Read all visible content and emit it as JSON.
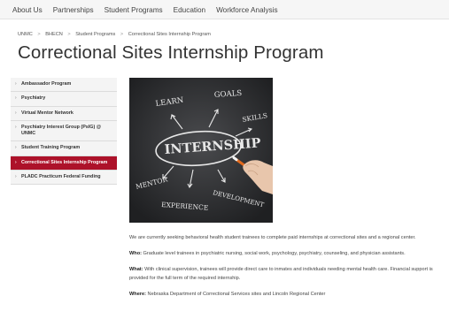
{
  "topnav": {
    "items": [
      "About Us",
      "Partnerships",
      "Student Programs",
      "Education",
      "Workforce Analysis"
    ]
  },
  "breadcrumb": {
    "items": [
      "UNMC",
      "BHECN",
      "Student Programs",
      "Correctional Sites Internship Program"
    ],
    "separator": ">"
  },
  "page": {
    "title": "Correctional Sites Internship Program"
  },
  "sidebar": {
    "active_color": "#ad122a",
    "items": [
      {
        "label": "Ambassador Program"
      },
      {
        "label": "Psychiatry"
      },
      {
        "label": "Virtual Mentor Network"
      },
      {
        "label": "Psychiatry Interest Group (PsIG) @ UNMC"
      },
      {
        "label": "Student Training Program"
      },
      {
        "label": "Correctional Sites Internship Program"
      },
      {
        "label": "PLADC Practicum Federal Funding"
      }
    ]
  },
  "hero_image": {
    "words": [
      "LEARN",
      "GOALS",
      "SKILLS",
      "INTERNSHIP",
      "MENTOR",
      "DEVELOPMENT",
      "EXPERIENCE"
    ]
  },
  "content": {
    "intro": "We are currently seeking behavioral health student trainees to complete paid internships at correctional sites and a regional center.",
    "who_label": "Who:",
    "who_text": " Graduate level trainees in psychiatric nursing, social work, psychology, psychiatry, counseling, and physician assistants.",
    "what_label": "What:",
    "what_text": " With clinical supervision, trainees will provide direct care to inmates and individuals needing mental health care. Financial support is provided for the full term of the required internship.",
    "where_label": "Where:",
    "where_text": " Nebraska Department of Correctional Services sites and Lincoln Regional Center"
  }
}
